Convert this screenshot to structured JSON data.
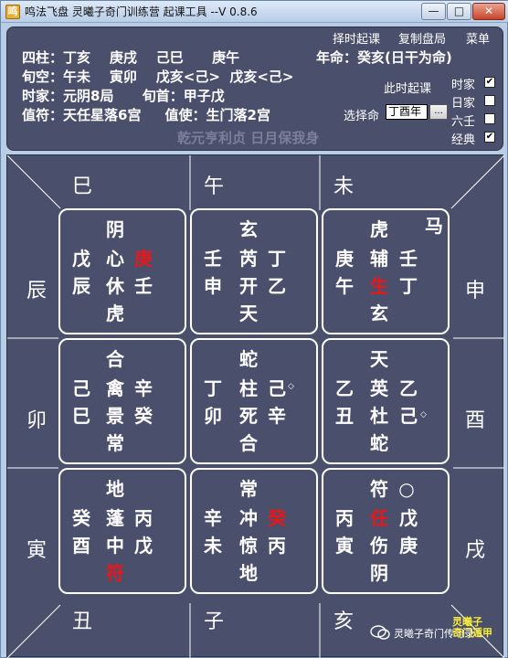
{
  "window": {
    "title": "鸣法飞盘    灵曦子奇门训练营 起课工具 --V 0.8.6",
    "controls": {
      "minimize": "—",
      "maximize": "□",
      "close": "✕"
    }
  },
  "menu": {
    "items": [
      "择时起课",
      "复制盘局",
      "菜单"
    ]
  },
  "info": {
    "line1": "四柱：丁亥    庚戌    己巳      庚午",
    "yearmeng": "年命：癸亥(日干为命)",
    "line2": "旬空：午未    寅卯    戊亥<己>  戊亥<己>",
    "line3": "时家：元阴8局      旬首：甲子戊",
    "line4": "值符：天任星落6宫     值使：生门落2宫",
    "motto": "乾元亨利贞 日月保我身",
    "now_link": "此时起课",
    "select_label": "选择命",
    "select_value": "丁酉年",
    "select_button": "...",
    "options": [
      {
        "label": "时家",
        "checked": true
      },
      {
        "label": "日家",
        "checked": false
      },
      {
        "label": "六壬",
        "checked": false
      },
      {
        "label": "经典",
        "checked": true
      }
    ]
  },
  "board": {
    "branches": {
      "si": "巳",
      "wu": "午",
      "wei": "未",
      "chen": "辰",
      "shen": "申",
      "mao": "卯",
      "you": "酉",
      "yin": "寅",
      "xu": "戌",
      "chou": "丑",
      "zi": "子",
      "hai": "亥"
    },
    "palaces": {
      "p4": {
        "god": "阴",
        "stem_l": "戊",
        "star": "心",
        "stem_r": "庚",
        "branch_l": "辰",
        "door": "休",
        "stem_r2": "壬",
        "deity": "虎"
      },
      "p9": {
        "god": "玄",
        "stem_l": "壬",
        "star": "芮",
        "stem_r": "丁",
        "branch_l": "申",
        "door": "开",
        "stem_r2": "乙",
        "deity": "天"
      },
      "p2": {
        "god": "虎",
        "horse": "马",
        "stem_l": "庚",
        "star": "辅",
        "stem_r": "壬",
        "branch_l": "午",
        "door": "生",
        "stem_r2": "丁",
        "deity": "玄"
      },
      "p3": {
        "god": "合",
        "stem_l": "己",
        "star": "禽",
        "stem_r": "辛",
        "branch_l": "巳",
        "door": "景",
        "stem_r2": "癸",
        "deity": "常"
      },
      "p5": {
        "god": "蛇",
        "stem_l": "丁",
        "star": "柱",
        "stem_r": "己",
        "branch_l": "卯",
        "door": "死",
        "stem_r2": "辛",
        "deity": "合"
      },
      "p7": {
        "god": "天",
        "stem_l": "乙",
        "star": "英",
        "stem_r": "乙",
        "branch_l": "丑",
        "door": "杜",
        "stem_r2": "己",
        "deity": "蛇"
      },
      "p8": {
        "god": "地",
        "stem_l": "癸",
        "star": "蓬",
        "stem_r": "丙",
        "branch_l": "酉",
        "door": "中",
        "stem_r2": "戊",
        "deity": "符"
      },
      "p1": {
        "god": "常",
        "stem_l": "辛",
        "star": "冲",
        "stem_r": "癸",
        "branch_l": "未",
        "door": "惊",
        "stem_r2": "丙",
        "deity": "地"
      },
      "p6": {
        "god": "符",
        "circle": "○",
        "stem_l": "丙",
        "star": "任",
        "stem_r": "戊",
        "branch_l": "寅",
        "door": "伤",
        "stem_r2": "庚",
        "deity": "阴"
      }
    },
    "diamond": "◇"
  },
  "watermark": {
    "text": "灵曦子奇门传习录",
    "corner_line1": "灵曦子",
    "corner_line2": "奇门遁甲"
  },
  "colors": {
    "panel": "#4a4f6c",
    "highlight": "#e8171a",
    "accent": "#f6ea3c"
  }
}
